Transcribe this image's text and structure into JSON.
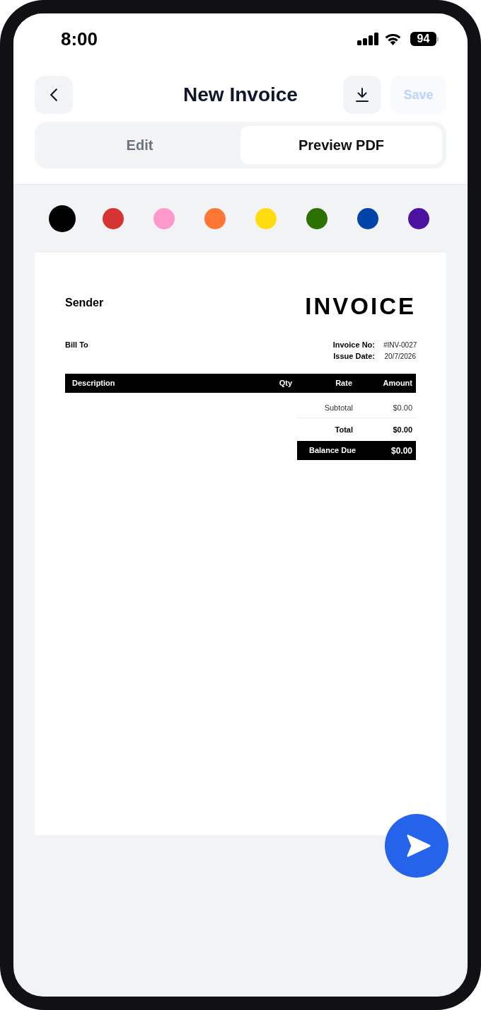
{
  "status_bar": {
    "time": "8:00",
    "battery": "94"
  },
  "header": {
    "title": "New Invoice",
    "save_button": {
      "label": "Save",
      "disabled": true
    }
  },
  "tabs": [
    {
      "label": "Edit",
      "selected": false
    },
    {
      "label": "Preview PDF",
      "selected": true
    }
  ],
  "color_swatches": [
    {
      "color": "#000000",
      "selected": true
    },
    {
      "color": "#d63333",
      "selected": false
    },
    {
      "color": "#ff99cc",
      "selected": false
    },
    {
      "color": "#ff7733",
      "selected": false
    },
    {
      "color": "#ffdd11",
      "selected": false
    },
    {
      "color": "#2b7300",
      "selected": false
    },
    {
      "color": "#0044aa",
      "selected": false
    },
    {
      "color": "#4a129e",
      "selected": false
    }
  ],
  "invoice": {
    "sender": "Sender",
    "title": "INVOICE",
    "bill_to": "Bill To",
    "meta": [
      {
        "label": "Invoice No:",
        "value": "#INV-0027"
      },
      {
        "label": "Issue Date:",
        "value": "20/7/2026"
      }
    ],
    "columns": [
      "Description",
      "Qty",
      "Rate",
      "Amount"
    ],
    "totals": [
      {
        "kind": "plain",
        "label": "Subtotal",
        "value": "$0.00"
      },
      {
        "kind": "bold",
        "label": "Total",
        "value": "$0.00"
      },
      {
        "kind": "highlight",
        "label": "Balance Due",
        "value": "$0.00"
      }
    ]
  }
}
